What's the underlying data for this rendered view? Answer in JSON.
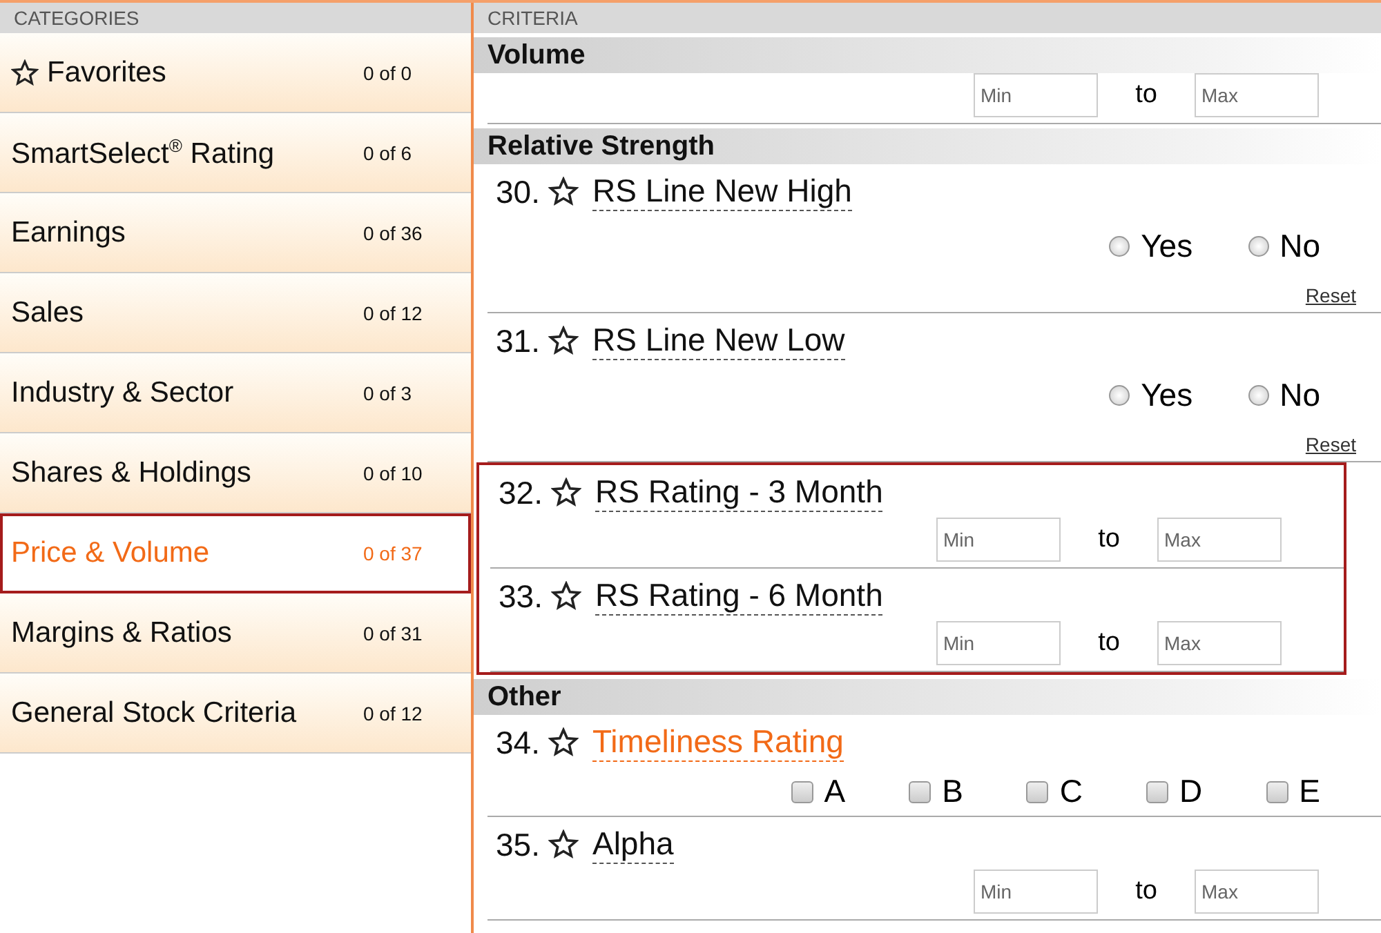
{
  "categories": {
    "title": "CATEGORIES",
    "items": [
      {
        "kind": "favorites",
        "label": "Favorites",
        "count": "0 of 0",
        "selected": false
      },
      {
        "kind": "plain",
        "label": "SmartSelect$^{®}$  Rating",
        "count": "0 of 6",
        "selected": false
      },
      {
        "kind": "plain",
        "label": "Earnings",
        "count": "0 of 36",
        "selected": false
      },
      {
        "kind": "plain",
        "label": "Sales",
        "count": "0 of 12",
        "selected": false
      },
      {
        "kind": "plain",
        "label": "Industry & Sector",
        "count": "0 of 3",
        "selected": false
      },
      {
        "kind": "plain",
        "label": "Shares & Holdings",
        "count": "0 of 10",
        "selected": false
      },
      {
        "kind": "plain",
        "label": "Price & Volume",
        "count": "0 of 37",
        "selected": true
      },
      {
        "kind": "plain",
        "label": "Margins & Ratios",
        "count": "0 of 31",
        "selected": false
      },
      {
        "kind": "plain",
        "label": "General Stock Criteria",
        "count": "0 of 12",
        "selected": false
      }
    ]
  },
  "criteria": {
    "title": "CRITERIA",
    "sections": [
      {
        "title": "Volume",
        "items": [
          {
            "kind": "range",
            "highlighted": false,
            "min_placeholder": "Min",
            "to": "to",
            "max_placeholder": "Max"
          }
        ]
      },
      {
        "title": "Relative Strength",
        "items": [
          {
            "kind": "yesno",
            "number": "30.",
            "label": "RS Line New High",
            "highlighted": false,
            "active": false,
            "options": [
              {
                "label": "Yes",
                "selected": false
              },
              {
                "label": "No",
                "selected": false
              }
            ],
            "reset": "Reset"
          },
          {
            "kind": "yesno",
            "number": "31.",
            "label": "RS Line New Low",
            "highlighted": false,
            "active": false,
            "options": [
              {
                "label": "Yes",
                "selected": false
              },
              {
                "label": "No",
                "selected": false
              }
            ],
            "reset": "Reset"
          },
          {
            "kind": "range",
            "number": "32.",
            "label": "RS Rating - 3 Month",
            "highlighted": true,
            "active": false,
            "min_placeholder": "Min",
            "to": "to",
            "max_placeholder": "Max"
          },
          {
            "kind": "range",
            "number": "33.",
            "label": "RS Rating - 6 Month",
            "highlighted": true,
            "active": false,
            "min_placeholder": "Min",
            "to": "to",
            "max_placeholder": "Max"
          }
        ]
      },
      {
        "title": "Other",
        "items": [
          {
            "kind": "letters",
            "number": "34.",
            "label": "Timeliness Rating",
            "highlighted": false,
            "active": true,
            "options": [
              {
                "label": "A",
                "checked": false
              },
              {
                "label": "B",
                "checked": false
              },
              {
                "label": "C",
                "checked": false
              },
              {
                "label": "D",
                "checked": false
              },
              {
                "label": "E",
                "checked": false
              }
            ]
          },
          {
            "kind": "range",
            "number": "35.",
            "label": "Alpha",
            "highlighted": false,
            "active": false,
            "min_placeholder": "Min",
            "to": "to",
            "max_placeholder": "Max"
          }
        ]
      }
    ]
  }
}
